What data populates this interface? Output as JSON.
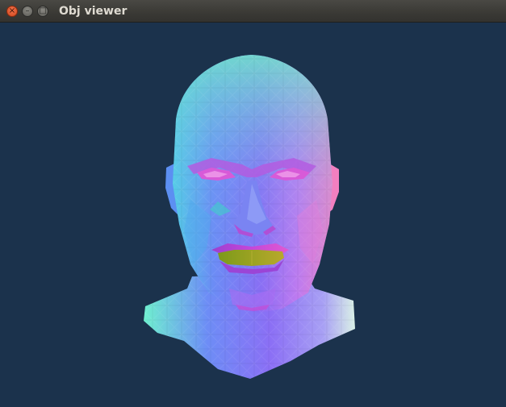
{
  "window": {
    "title": "Obj viewer",
    "close_glyph": "×",
    "min_glyph": "–",
    "max_glyph": "□"
  },
  "viewport": {
    "background": "#1b324c",
    "model": "head-mesh-normal-shaded"
  },
  "icons": {
    "close": "close-icon",
    "minimize": "minimize-icon",
    "maximize": "maximize-icon"
  }
}
